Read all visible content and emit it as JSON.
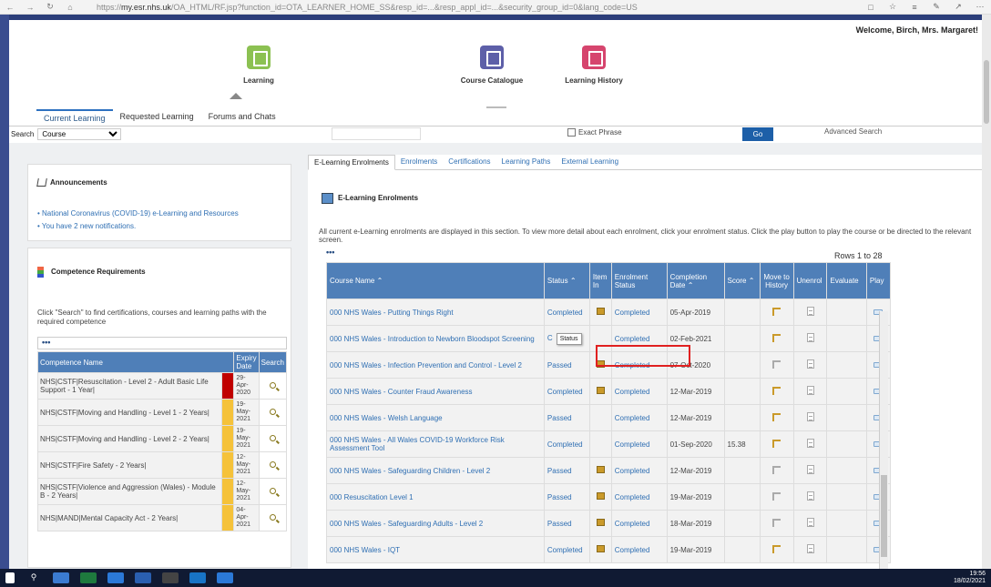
{
  "browser": {
    "url_host": "my.esr.nhs.uk",
    "url_rest": "/OA_HTML/RF.jsp?function_id=OTA_LEARNER_HOME_SS&resp_id=...&resp_appl_id=...&security_group_id=0&lang_code=US",
    "url_prefix": "https://"
  },
  "header": {
    "welcome": "Welcome, Birch, Mrs. Margaret!"
  },
  "hub": {
    "items": [
      {
        "label": "Learning",
        "color": "#8cc152"
      },
      {
        "label": "Course Catalogue",
        "color": "#5d5fa8"
      },
      {
        "label": "Learning History",
        "color": "#d6456e"
      }
    ]
  },
  "tabs": [
    "Current Learning",
    "Requested Learning",
    "Forums and Chats"
  ],
  "search": {
    "label": "Search",
    "option": "Course",
    "exact_phrase": "Exact Phrase",
    "go": "Go",
    "advanced": "Advanced Search"
  },
  "announcements": {
    "title": "Announcements",
    "links": [
      "National Coronavirus (COVID-19) e-Learning and Resources",
      "You have 2 new notifications."
    ]
  },
  "competence": {
    "title": "Competence Requirements",
    "desc": "Click \"Search\" to find certifications, courses and learning paths with the required competence",
    "dots": "•••",
    "headers": [
      "Competence Name",
      "Expiry Date",
      "Search"
    ],
    "rows": [
      {
        "name": "NHS|CSTF|Resuscitation - Level 2 - Adult Basic Life Support - 1 Year|",
        "date": "29-Apr-2020",
        "color": "#c00000"
      },
      {
        "name": "NHS|CSTF|Moving and Handling - Level 1 - 2 Years|",
        "date": "19-May-2021",
        "color": "#f5c23a"
      },
      {
        "name": "NHS|CSTF|Moving and Handling - Level 2 - 2 Years|",
        "date": "19-May-2021",
        "color": "#f5c23a"
      },
      {
        "name": "NHS|CSTF|Fire Safety - 2 Years|",
        "date": "12-May-2021",
        "color": "#f5c23a"
      },
      {
        "name": "NHS|CSTF|Violence and Aggression (Wales) - Module B - 2 Years|",
        "date": "12-May-2021",
        "color": "#f5c23a"
      },
      {
        "name": "NHS|MAND|Mental Capacity Act - 2 Years|",
        "date": "04-Apr-2021",
        "color": "#f5c23a"
      }
    ]
  },
  "main_tabs": [
    "E-Learning Enrolments",
    "Enrolments",
    "Certifications",
    "Learning Paths",
    "External Learning"
  ],
  "enrolments": {
    "title": "E-Learning Enrolments",
    "desc": "All current e-Learning enrolments are displayed in this section. To view more detail about each enrolment, click your enrolment status. Click the play button to play the course or be directed to the relevant screen.",
    "dots": "•••",
    "rows_label": "Rows 1 to 28",
    "headers": [
      "Course Name",
      "Status",
      "Item In",
      "Enrolment Status",
      "Completion Date",
      "Score",
      "Move to History",
      "Unenrol",
      "Evaluate",
      "Play"
    ],
    "tooltip": "Status",
    "rows": [
      {
        "course": "000 NHS Wales - Putting Things Right",
        "status": "Completed",
        "item": true,
        "enrol": "Completed",
        "date": "05-Apr-2019",
        "score": "",
        "hist_active": true
      },
      {
        "course": "000 NHS Wales - Introduction to Newborn Bloodspot Screening",
        "status": "C",
        "item": false,
        "enrol": "Completed",
        "date": "02-Feb-2021",
        "score": "",
        "hist_active": true,
        "tooltip": true
      },
      {
        "course": "000 NHS Wales - Infection Prevention and Control - Level 2",
        "status": "Passed",
        "item": true,
        "enrol": "Completed",
        "date": "07-Oct-2020",
        "score": "",
        "hist_active": false
      },
      {
        "course": "000 NHS Wales - Counter Fraud Awareness",
        "status": "Completed",
        "item": true,
        "enrol": "Completed",
        "date": "12-Mar-2019",
        "score": "",
        "hist_active": true
      },
      {
        "course": "000 NHS Wales - Welsh Language",
        "status": "Passed",
        "item": false,
        "enrol": "Completed",
        "date": "12-Mar-2019",
        "score": "",
        "hist_active": true
      },
      {
        "course": "000 NHS Wales - All Wales COVID-19 Workforce Risk Assessment Tool",
        "status": "Completed",
        "item": false,
        "enrol": "Completed",
        "date": "01-Sep-2020",
        "score": "15.38",
        "hist_active": true
      },
      {
        "course": "000 NHS Wales - Safeguarding Children - Level 2",
        "status": "Passed",
        "item": true,
        "enrol": "Completed",
        "date": "12-Mar-2019",
        "score": "",
        "hist_active": false
      },
      {
        "course": "000 Resuscitation Level 1",
        "status": "Passed",
        "item": true,
        "enrol": "Completed",
        "date": "19-Mar-2019",
        "score": "",
        "hist_active": false
      },
      {
        "course": "000 NHS Wales - Safeguarding Adults - Level 2",
        "status": "Passed",
        "item": true,
        "enrol": "Completed",
        "date": "18-Mar-2019",
        "score": "",
        "hist_active": false
      },
      {
        "course": "000 NHS Wales - IQT",
        "status": "Completed",
        "item": true,
        "enrol": "Completed",
        "date": "19-Mar-2019",
        "score": "",
        "hist_active": true
      }
    ]
  },
  "taskbar": {
    "time": "19:56",
    "date": "18/02/2021"
  }
}
